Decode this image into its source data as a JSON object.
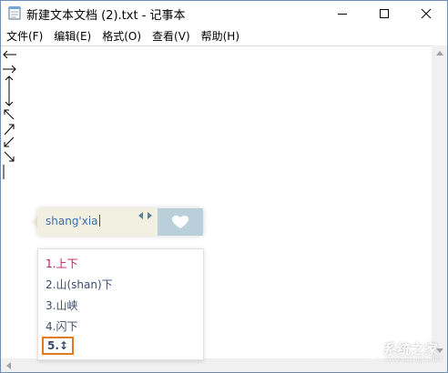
{
  "window": {
    "title": "新建文本文档 (2).txt - 记事本"
  },
  "menu": {
    "items": [
      "文件(F)",
      "编辑(E)",
      "格式(O)",
      "查看(V)",
      "帮助(H)"
    ]
  },
  "editor": {
    "glyphs": [
      "←",
      "→",
      "↕",
      "↖",
      "↗",
      "↙",
      "↘",
      "|"
    ]
  },
  "ime": {
    "pinyin": "shang'xia",
    "candidates": [
      "1.上下",
      "2.山(shan)下",
      "3.山峡",
      "4.闪下",
      "5.↕"
    ],
    "selected_index": 4
  },
  "icons": {
    "app": "notepad-icon",
    "minimize": "minimize-icon",
    "maximize": "maximize-icon",
    "close": "close-icon",
    "ime_logo": "heart-logo-icon",
    "page_prev": "caret-left-icon",
    "page_next": "caret-right-icon"
  },
  "colors": {
    "ime_bar": "#f2f0e1",
    "ime_logo_bg": "#b9cfda",
    "candidate_first": "#c2185b",
    "selection_border": "#e07b22",
    "pinyin": "#3a6fb1"
  },
  "watermark": {
    "text": "系统之家",
    "sub": "XITONGZHIJIA.NET"
  }
}
